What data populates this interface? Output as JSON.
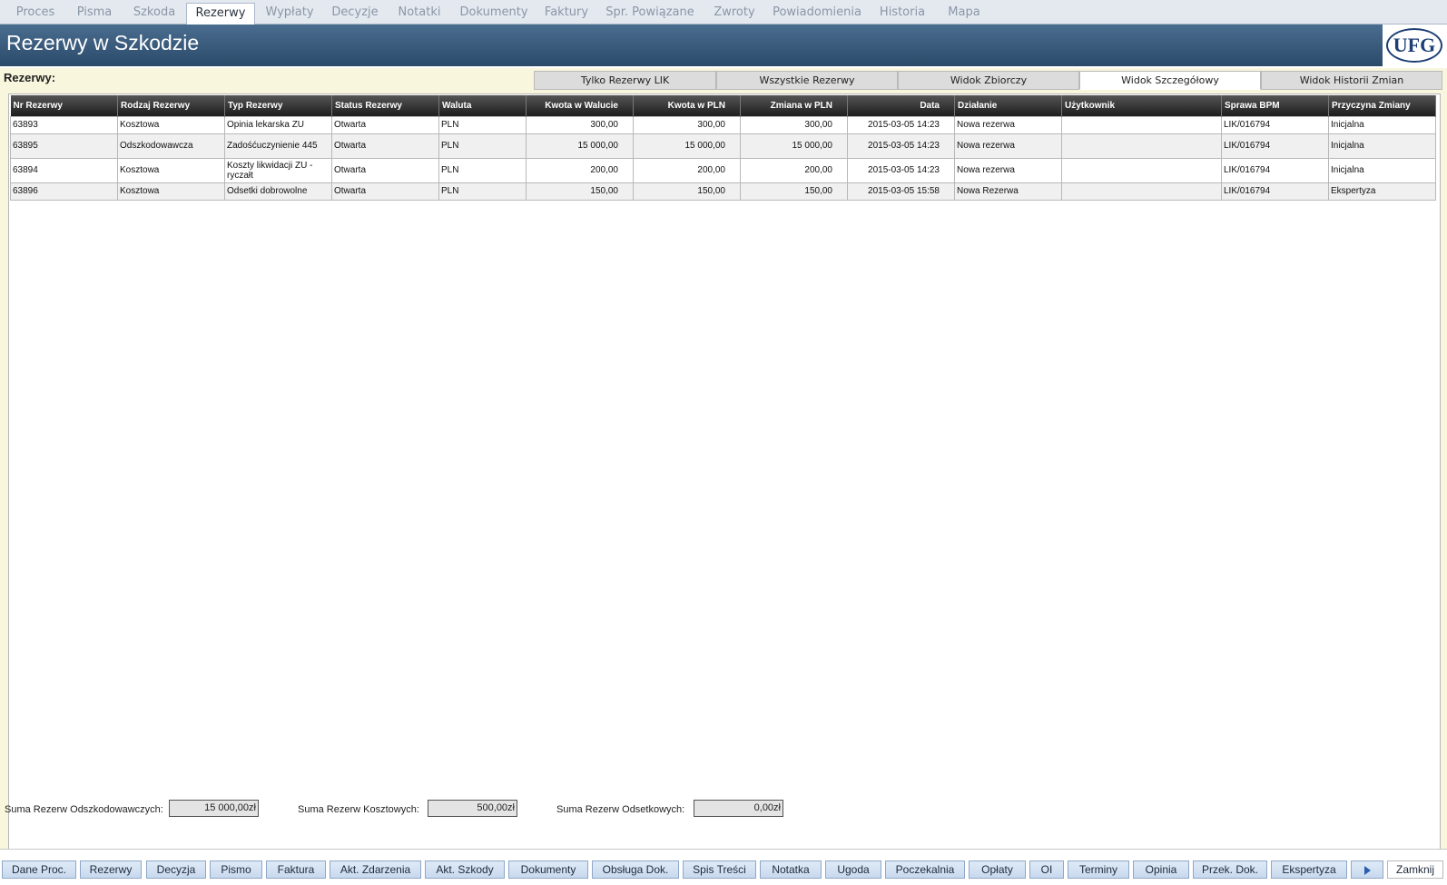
{
  "top_tabs": [
    "Proces",
    "Pisma",
    "Szkoda",
    "Rezerwy",
    "Wypłaty",
    "Decyzje",
    "Notatki",
    "Dokumenty",
    "Faktury",
    "Spr. Powiązane",
    "Zwroty",
    "Powiadomienia",
    "Historia",
    "Mapa"
  ],
  "active_top_tab": "Rezerwy",
  "title": "Rezerwy w Szkodzie",
  "logo_text": "UFG",
  "panel_label": "Rezerwy:",
  "view_tabs": [
    "Tylko Rezerwy LIK",
    "Wszystkie Rezerwy",
    "Widok Zbiorczy",
    "Widok Szczegółowy",
    "Widok Historii Zmian"
  ],
  "active_view_tab": "Widok Szczegółowy",
  "table": {
    "headers": [
      "Nr Rezerwy",
      "Rodzaj Rezerwy",
      "Typ Rezerwy",
      "Status Rezerwy",
      "Waluta",
      "Kwota w Walucie",
      "Kwota w PLN",
      "Zmiana w PLN",
      "Data",
      "Działanie",
      "Użytkownik",
      "Sprawa BPM",
      "Przyczyna Zmiany"
    ],
    "rows": [
      [
        "63893",
        "Kosztowa",
        "Opinia lekarska ZU",
        "Otwarta",
        "PLN",
        "300,00",
        "300,00",
        "300,00",
        "2015-03-05 14:23",
        "Nowa rezerwa",
        "",
        "LIK/016794",
        "Inicjalna"
      ],
      [
        "63895",
        "Odszkodowawcza",
        "Zadośćuczynienie 445",
        "Otwarta",
        "PLN",
        "15 000,00",
        "15 000,00",
        "15 000,00",
        "2015-03-05 14:23",
        "Nowa rezerwa",
        "",
        "LIK/016794",
        "Inicjalna"
      ],
      [
        "63894",
        "Kosztowa",
        "Koszty likwidacji ZU - ryczałt",
        "Otwarta",
        "PLN",
        "200,00",
        "200,00",
        "200,00",
        "2015-03-05 14:23",
        "Nowa rezerwa",
        "",
        "LIK/016794",
        "Inicjalna"
      ],
      [
        "63896",
        "Kosztowa",
        "Odsetki dobrowolne",
        "Otwarta",
        "PLN",
        "150,00",
        "150,00",
        "150,00",
        "2015-03-05 15:58",
        "Nowa Rezerwa",
        "",
        "LIK/016794",
        "Ekspertyza"
      ]
    ]
  },
  "sums": {
    "odszk_label": "Suma Rezerw Odszkodowawczych:",
    "odszk_value": "15 000,00zł",
    "koszt_label": "Suma Rezerw Kosztowych:",
    "koszt_value": "500,00zł",
    "odset_label": "Suma Rezerw Odsetkowych:",
    "odset_value": "0,00zł"
  },
  "bottom_buttons": [
    "Dane Proc.",
    "Rezerwy",
    "Decyzja",
    "Pismo",
    "Faktura",
    "Akt. Zdarzenia",
    "Akt. Szkody",
    "Dokumenty",
    "Obsługa Dok.",
    "Spis Treści",
    "Notatka",
    "Ugoda",
    "Poczekalnia",
    "Opłaty",
    "OI",
    "Terminy",
    "Opinia",
    "Przek. Dok.",
    "Ekspertyza"
  ],
  "more_icon": "play-right-icon",
  "close_label": "Zamknij"
}
